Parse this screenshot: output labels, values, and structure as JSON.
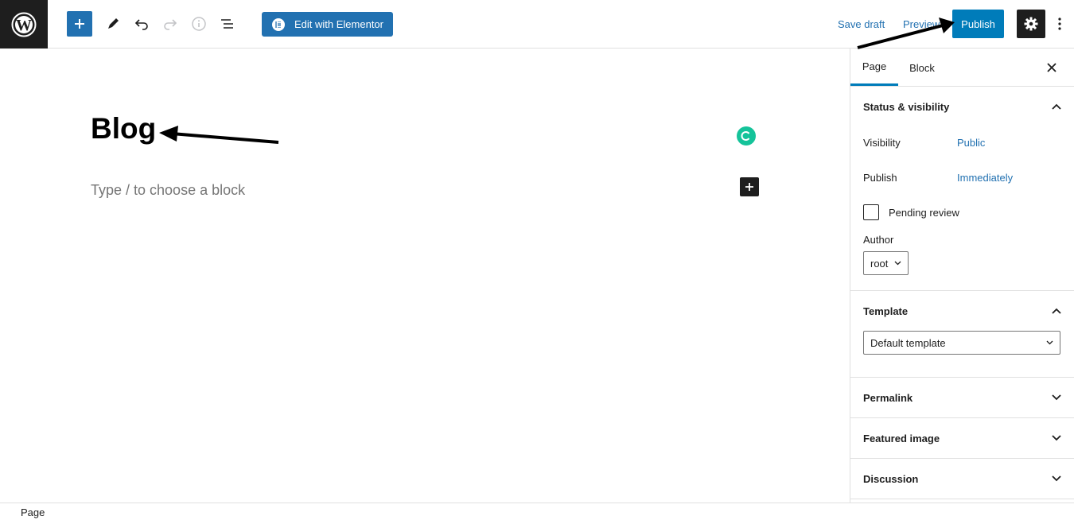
{
  "toolbar": {
    "elementor_label": "Edit with Elementor",
    "save_draft_label": "Save draft",
    "preview_label": "Preview",
    "publish_label": "Publish",
    "icons": [
      "wordpress-icon",
      "plus-icon",
      "pencil-icon",
      "undo-icon",
      "redo-icon",
      "info-icon",
      "list-view-icon",
      "gear-icon",
      "more-vertical-icon"
    ]
  },
  "editor": {
    "title": "Blog",
    "block_placeholder": "Type / to choose a block"
  },
  "sidebar": {
    "tabs": [
      {
        "label": "Page",
        "active": true
      },
      {
        "label": "Block",
        "active": false
      }
    ],
    "status_visibility": {
      "heading": "Status & visibility",
      "visibility_label": "Visibility",
      "visibility_value": "Public",
      "publish_label": "Publish",
      "publish_value": "Immediately",
      "pending_review_label": "Pending review",
      "author_label": "Author",
      "author_value": "root"
    },
    "template": {
      "heading": "Template",
      "value": "Default template"
    },
    "permalink": {
      "heading": "Permalink"
    },
    "featured_image": {
      "heading": "Featured image"
    },
    "discussion": {
      "heading": "Discussion"
    }
  },
  "footer": {
    "breadcrumb": "Page"
  },
  "colors": {
    "accent": "#007cba",
    "link": "#2271b1",
    "dark": "#1e1e1e",
    "grammarly": "#15c39a"
  }
}
